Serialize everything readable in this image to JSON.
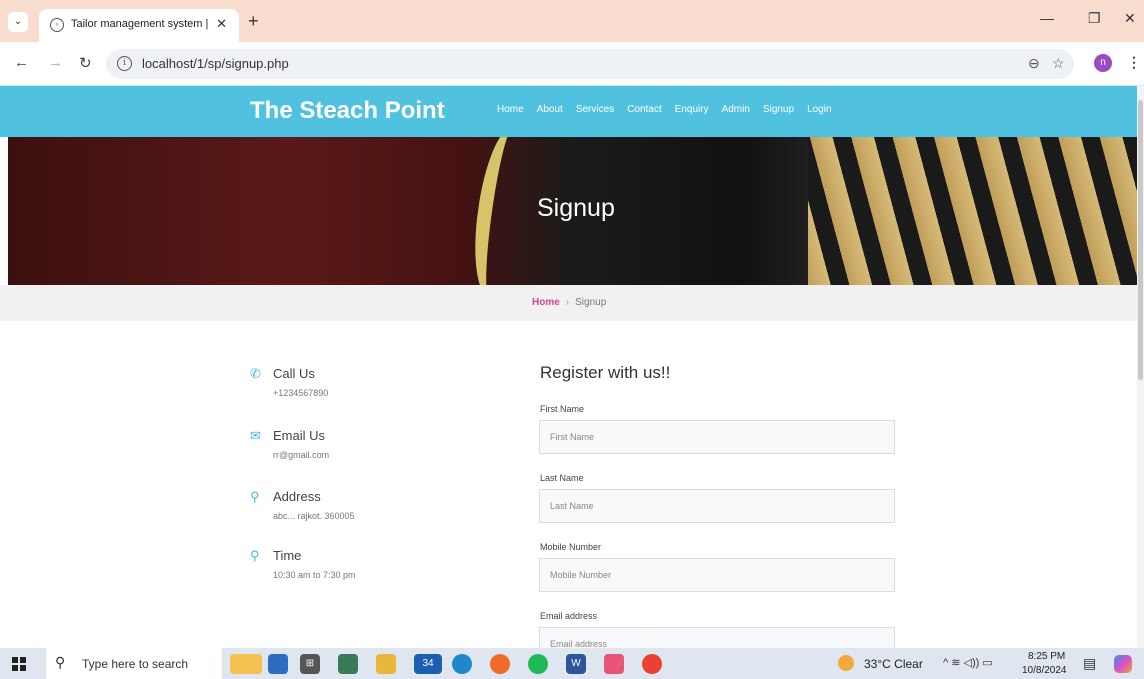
{
  "browser": {
    "tab_title": "Tailor management system | Sig",
    "tab_close": "✕",
    "new_tab": "+",
    "url": "localhost/1/sp/signup.php",
    "window_controls": {
      "minimize": "—",
      "restore": "❐",
      "close": "✕"
    }
  },
  "site": {
    "brand": "The Steach Point",
    "nav": [
      "Home",
      "About",
      "Services",
      "Contact",
      "Enquiry",
      "Admin",
      "Signup",
      "Login"
    ],
    "accent_color": "#50c2e0"
  },
  "hero": {
    "title": "Signup"
  },
  "breadcrumb": {
    "home": "Home",
    "separator": "›",
    "current": "Signup"
  },
  "contact": [
    {
      "icon": "phone-icon",
      "title": "Call Us",
      "value": "+1234567890"
    },
    {
      "icon": "mail-icon",
      "title": "Email Us",
      "value": "rr@gmail.com"
    },
    {
      "icon": "location-pin-icon",
      "title": "Address",
      "value": "abc... rajkot. 360005"
    },
    {
      "icon": "location-pin-icon",
      "title": "Time",
      "value": "10:30 am to 7:30 pm"
    }
  ],
  "form": {
    "title": "Register with us!!",
    "fields": [
      {
        "label": "First Name",
        "placeholder": "First Name"
      },
      {
        "label": "Last Name",
        "placeholder": "Last Name"
      },
      {
        "label": "Mobile Number",
        "placeholder": "Mobile Number"
      },
      {
        "label": "Email address",
        "placeholder": "Email address"
      }
    ]
  },
  "taskbar": {
    "search_placeholder": "Type here to search",
    "mail_badge": "34",
    "weather": "33°C  Clear",
    "time": "8:25 PM",
    "date": "10/8/2024"
  }
}
